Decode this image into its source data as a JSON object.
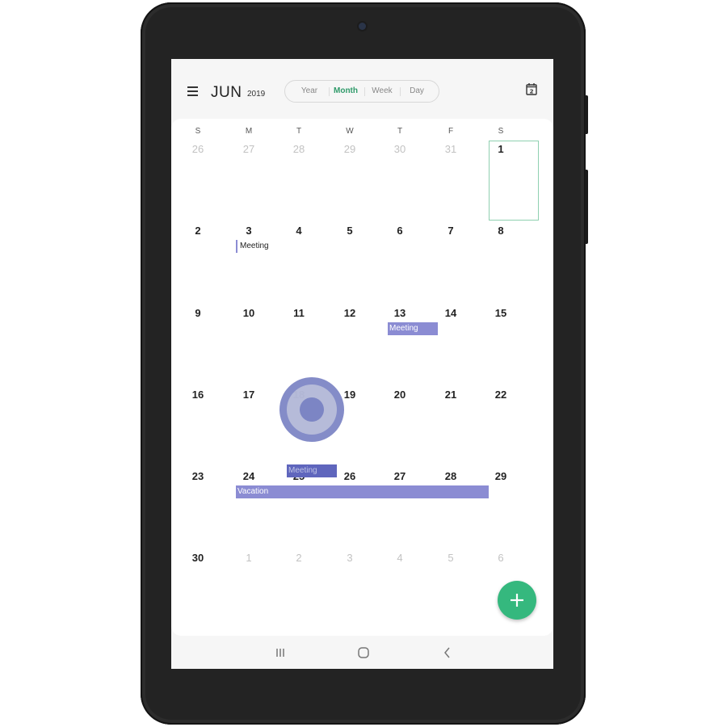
{
  "header": {
    "month": "JUN",
    "year": "2019",
    "views": [
      "Year",
      "Month",
      "Week",
      "Day"
    ],
    "active_view": "Month",
    "today_icon_label": "2"
  },
  "weekdays": [
    "S",
    "M",
    "T",
    "W",
    "T",
    "F",
    "S"
  ],
  "weeks": [
    [
      "26",
      "27",
      "28",
      "29",
      "30",
      "31",
      "1"
    ],
    [
      "2",
      "3",
      "4",
      "5",
      "6",
      "7",
      "8"
    ],
    [
      "9",
      "10",
      "11",
      "12",
      "13",
      "14",
      "15"
    ],
    [
      "16",
      "17",
      "18",
      "19",
      "20",
      "21",
      "22"
    ],
    [
      "23",
      "24",
      "25",
      "26",
      "27",
      "28",
      "29"
    ],
    [
      "30",
      "1",
      "2",
      "3",
      "4",
      "5",
      "6"
    ]
  ],
  "events": {
    "jun3": "Meeting",
    "jun13": "Meeting",
    "jun18": "Meeting",
    "vacation": "Vacation"
  },
  "colors": {
    "accent": "#2f9a6a",
    "fab": "#35b87e",
    "event": "#8b8cd3",
    "today_border": "#8fd0b0"
  },
  "icons": {
    "menu": "hamburger-icon",
    "today": "calendar-today-icon",
    "fab": "plus-icon",
    "nav_recent": "recent-apps-icon",
    "nav_home": "home-icon",
    "nav_back": "back-icon"
  }
}
